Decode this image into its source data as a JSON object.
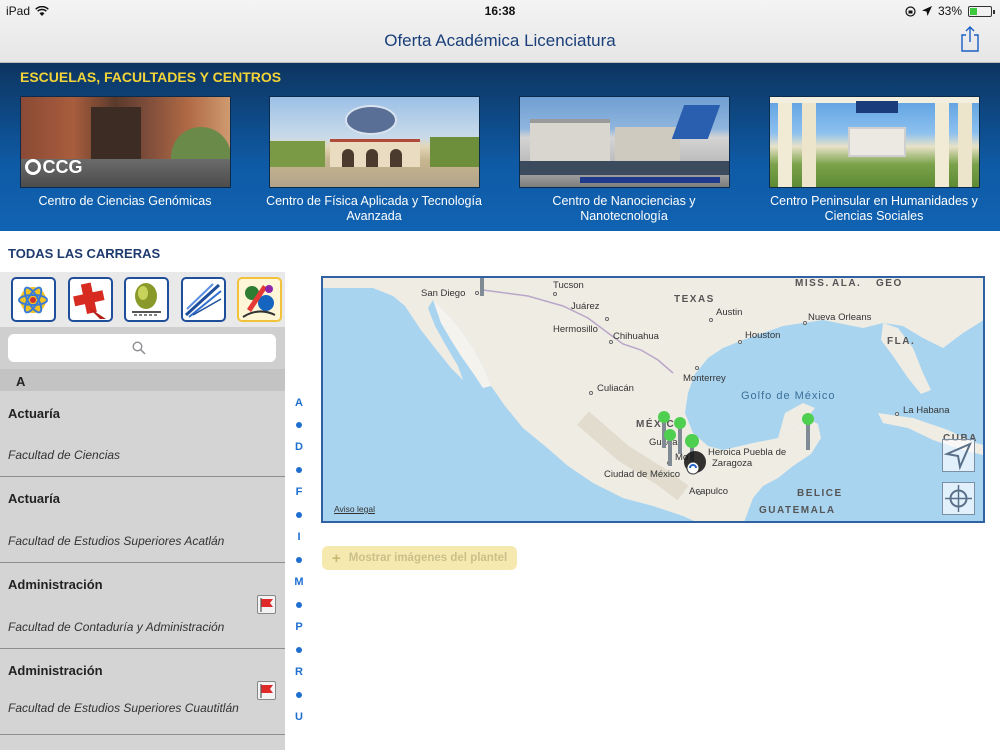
{
  "status": {
    "device": "iPad",
    "time": "16:38",
    "battery": "33%",
    "battery_level": 0.33
  },
  "nav": {
    "title": "Oferta Académica Licenciatura"
  },
  "schools": {
    "heading": "ESCUELAS, FACULTADES Y CENTROS",
    "items": [
      {
        "name": "Centro de Ciencias Genómicas",
        "logo": "CCG"
      },
      {
        "name": "Centro de Física Aplicada y Tecnología Avanzada"
      },
      {
        "name": "Centro de Nanociencias y Nanotecnología"
      },
      {
        "name": "Centro Peninsular en Humanidades y Ciencias Sociales"
      }
    ]
  },
  "careers": {
    "heading": "TODAS LAS CARRERAS",
    "categories": [
      "atom-icon",
      "health-cross-icon",
      "shield-icon",
      "engineering-icon",
      "arts-icon"
    ],
    "search_placeholder": "",
    "section": "A",
    "rows": [
      {
        "title": "Actuaría",
        "faculty": "Facultad de Ciencias",
        "flag": false
      },
      {
        "title": "Actuaría",
        "faculty": "Facultad de Estudios Superiores Acatlán",
        "flag": false
      },
      {
        "title": "Administración",
        "faculty": "Facultad de Contaduría y Administración",
        "flag": true
      },
      {
        "title": "Administración",
        "faculty": "Facultad de Estudios Superiores Cuautitlán",
        "flag": true
      }
    ],
    "index_letters": [
      "A",
      "D",
      "F",
      "I",
      "M",
      "P",
      "R",
      "U"
    ]
  },
  "map": {
    "labels": {
      "san_diego": "San Diego",
      "tucson": "Tucson",
      "juarez": "Juárez",
      "texas": "TEXAS",
      "miss": "MISS.",
      "ala": "ALA.",
      "geo": "GEO",
      "hermosillo": "Hermosillo",
      "austin": "Austin",
      "nueva_orleans": "Nueva Orleans",
      "chihuahua": "Chihuahua",
      "houston": "Houston",
      "fla": "FLA.",
      "monterrey": "Monterrey",
      "culiacan": "Culiacán",
      "golfo": "Golfo de México",
      "mexico": "MÉXICO",
      "la_habana": "La Habana",
      "guada": "Guada",
      "cuba": "CUBA",
      "mon": "Mo",
      "heroica": "Heroica Puebla de",
      "zaragoza": "Zaragoza",
      "ciudad_mexico": "Ciudad de México",
      "acapulco": "Acapulco",
      "belice": "BELICE",
      "guatemala": "GUATEMALA"
    },
    "legal": "Aviso legal"
  },
  "show_images": "Mostrar imágenes del plantel",
  "colors": {
    "banner": "#0f5aa5",
    "accent_yellow": "#f2d43a",
    "link": "#1e6fd0"
  }
}
